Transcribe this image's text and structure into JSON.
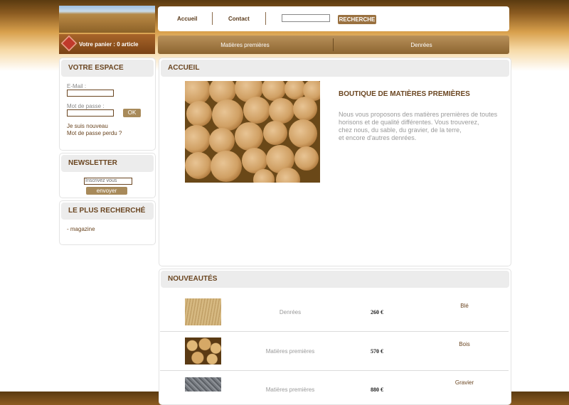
{
  "header": {
    "cart_label": "Votre panier : 0 article",
    "nav": [
      "Accueil",
      "Contact"
    ],
    "search_button": "RECHERCHE",
    "search_value": ""
  },
  "categories": [
    "Matières premières",
    "Denrées"
  ],
  "sidebar": {
    "account": {
      "title": "VOTRE ESPACE",
      "email_label": "E-Mail :",
      "password_label": "Mot de passe :",
      "ok_label": "OK",
      "new_user_link": "Je suis nouveau",
      "lost_password_link": "Mot de passe perdu ?"
    },
    "newsletter": {
      "title": "NEWSLETTER",
      "input_value": "Inscrivez vous",
      "send_label": "envoyer"
    },
    "popular": {
      "title": "LE PLUS RECHERCHÉ",
      "items": [
        "- magazine"
      ]
    }
  },
  "main": {
    "home_title": "ACCUEIL",
    "hero_title": "BOUTIQUE DE MATIÈRES PREMIÈRES",
    "hero_lines": [
      "Nous vous proposons des matières premières de toutes",
      "horisons et de qualité différentes. Vous trouverez,",
      "chez nous, du sable, du gravier, de la terre,",
      "et encore d'autres denrées."
    ],
    "news_title": "NOUVEAUTÉS",
    "products": [
      {
        "category": "Denrées",
        "price": "260 €",
        "name": "Blé",
        "thumb": "wheat"
      },
      {
        "category": "Matières premières",
        "price": "570 €",
        "name": "Bois",
        "thumb": "logs"
      },
      {
        "category": "Matières premières",
        "price": "880 €",
        "name": "Gravier",
        "thumb": "gravel"
      }
    ]
  },
  "colors": {
    "brand_brown": "#6a4520",
    "button_tan": "#9a7140",
    "header_orange": "#d8a04c"
  }
}
